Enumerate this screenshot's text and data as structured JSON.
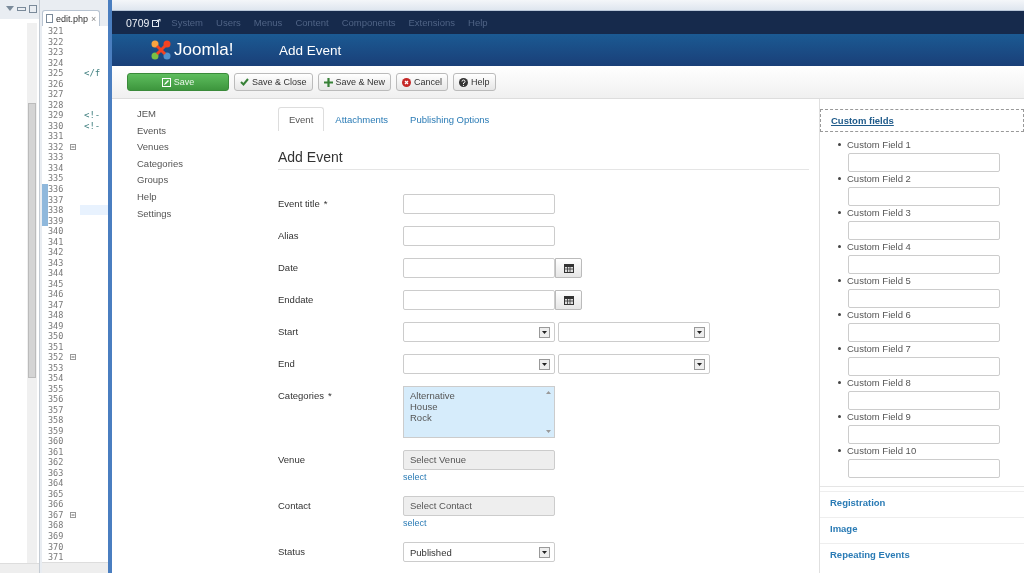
{
  "editor": {
    "tab": {
      "label": "edit.php",
      "close": "×"
    },
    "lines": [
      {
        "number": "321",
        "changed": false,
        "current": false,
        "fold": false
      },
      {
        "number": "322",
        "changed": false,
        "current": false,
        "fold": false
      },
      {
        "number": "323",
        "changed": false,
        "current": false,
        "fold": false
      },
      {
        "number": "324",
        "changed": false,
        "current": false,
        "fold": false
      },
      {
        "number": "325",
        "changed": false,
        "current": false,
        "fold": false,
        "code": "</f"
      },
      {
        "number": "326",
        "changed": false,
        "current": false,
        "fold": false
      },
      {
        "number": "327",
        "changed": false,
        "current": false,
        "fold": false
      },
      {
        "number": "328",
        "changed": false,
        "current": false,
        "fold": false
      },
      {
        "number": "329",
        "changed": false,
        "current": false,
        "fold": false,
        "code": "<!-"
      },
      {
        "number": "330",
        "changed": false,
        "current": false,
        "fold": false,
        "code": "<!-"
      },
      {
        "number": "331",
        "changed": false,
        "current": false,
        "fold": false
      },
      {
        "number": "332",
        "changed": false,
        "current": false,
        "fold": true
      },
      {
        "number": "333",
        "changed": false,
        "current": false,
        "fold": false
      },
      {
        "number": "334",
        "changed": false,
        "current": false,
        "fold": false
      },
      {
        "number": "335",
        "changed": false,
        "current": false,
        "fold": false
      },
      {
        "number": "336",
        "changed": true,
        "current": false,
        "fold": false
      },
      {
        "number": "337",
        "changed": true,
        "current": false,
        "fold": false
      },
      {
        "number": "338",
        "changed": true,
        "current": true,
        "fold": false
      },
      {
        "number": "339",
        "changed": true,
        "current": false,
        "fold": false
      },
      {
        "number": "340",
        "changed": false,
        "current": false,
        "fold": false
      },
      {
        "number": "341",
        "changed": false,
        "current": false,
        "fold": false
      },
      {
        "number": "342",
        "changed": false,
        "current": false,
        "fold": false
      },
      {
        "number": "343",
        "changed": false,
        "current": false,
        "fold": false
      },
      {
        "number": "344",
        "changed": false,
        "current": false,
        "fold": false
      },
      {
        "number": "345",
        "changed": false,
        "current": false,
        "fold": false
      },
      {
        "number": "346",
        "changed": false,
        "current": false,
        "fold": false
      },
      {
        "number": "347",
        "changed": false,
        "current": false,
        "fold": false
      },
      {
        "number": "348",
        "changed": false,
        "current": false,
        "fold": false
      },
      {
        "number": "349",
        "changed": false,
        "current": false,
        "fold": false
      },
      {
        "number": "350",
        "changed": false,
        "current": false,
        "fold": false
      },
      {
        "number": "351",
        "changed": false,
        "current": false,
        "fold": false
      },
      {
        "number": "352",
        "changed": false,
        "current": false,
        "fold": true
      },
      {
        "number": "353",
        "changed": false,
        "current": false,
        "fold": false
      },
      {
        "number": "354",
        "changed": false,
        "current": false,
        "fold": false
      },
      {
        "number": "355",
        "changed": false,
        "current": false,
        "fold": false
      },
      {
        "number": "356",
        "changed": false,
        "current": false,
        "fold": false
      },
      {
        "number": "357",
        "changed": false,
        "current": false,
        "fold": false
      },
      {
        "number": "358",
        "changed": false,
        "current": false,
        "fold": false
      },
      {
        "number": "359",
        "changed": false,
        "current": false,
        "fold": false
      },
      {
        "number": "360",
        "changed": false,
        "current": false,
        "fold": false
      },
      {
        "number": "361",
        "changed": false,
        "current": false,
        "fold": false
      },
      {
        "number": "362",
        "changed": false,
        "current": false,
        "fold": false
      },
      {
        "number": "363",
        "changed": false,
        "current": false,
        "fold": false
      },
      {
        "number": "364",
        "changed": false,
        "current": false,
        "fold": false
      },
      {
        "number": "365",
        "changed": false,
        "current": false,
        "fold": false
      },
      {
        "number": "366",
        "changed": false,
        "current": false,
        "fold": false
      },
      {
        "number": "367",
        "changed": false,
        "current": false,
        "fold": true
      },
      {
        "number": "368",
        "changed": false,
        "current": false,
        "fold": false
      },
      {
        "number": "369",
        "changed": false,
        "current": false,
        "fold": false
      },
      {
        "number": "370",
        "changed": false,
        "current": false,
        "fold": false
      },
      {
        "number": "371",
        "changed": false,
        "current": false,
        "fold": false
      }
    ]
  },
  "navbar": {
    "site": "0709",
    "menus": [
      {
        "label": "System",
        "disabled": true
      },
      {
        "label": "Users",
        "disabled": true
      },
      {
        "label": "Menus",
        "disabled": true
      },
      {
        "label": "Content",
        "disabled": true
      },
      {
        "label": "Components",
        "disabled": true
      },
      {
        "label": "Extensions",
        "disabled": true
      },
      {
        "label": "Help",
        "disabled": true
      }
    ]
  },
  "header": {
    "logo": "Joomla!",
    "title": "Add Event"
  },
  "toolbar": [
    {
      "label": "Save",
      "kind": "primary"
    },
    {
      "label": "Save & Close",
      "kind": "default"
    },
    {
      "label": "Save & New",
      "kind": "default"
    },
    {
      "label": "Cancel",
      "kind": "default"
    },
    {
      "label": "Help",
      "kind": "default"
    }
  ],
  "sidebar": {
    "items": [
      "JEM",
      "Events",
      "Venues",
      "Categories",
      "Groups",
      "Help",
      "Settings"
    ]
  },
  "tabs": [
    {
      "label": "Event",
      "selected": true
    },
    {
      "label": "Attachments",
      "selected": false
    },
    {
      "label": "Publishing Options",
      "selected": false
    }
  ],
  "form": {
    "heading": "Add Event",
    "fields": [
      {
        "label": "Event title",
        "required": "*",
        "kind": "text"
      },
      {
        "label": "Alias",
        "kind": "text"
      },
      {
        "label": "Date",
        "kind": "date"
      },
      {
        "label": "Enddate",
        "kind": "date"
      },
      {
        "label": "Start",
        "kind": "time"
      },
      {
        "label": "End",
        "kind": "time"
      },
      {
        "label": "Categories",
        "required": "*",
        "kind": "listbox",
        "options": [
          "Alternative",
          "House",
          "Rock"
        ]
      },
      {
        "label": "Venue",
        "kind": "modal",
        "value": "Select Venue",
        "link": "select"
      },
      {
        "label": "Contact",
        "kind": "modal",
        "value": "Select Contact",
        "link": "select"
      },
      {
        "label": "Status",
        "kind": "select",
        "value": "Published"
      }
    ]
  },
  "panel": {
    "sections": [
      {
        "title": "Custom fields",
        "expanded": true,
        "items": [
          "Custom Field 1",
          "Custom Field 2",
          "Custom Field 3",
          "Custom Field 4",
          "Custom Field 5",
          "Custom Field 6",
          "Custom Field 7",
          "Custom Field 8",
          "Custom Field 9",
          "Custom Field 10"
        ]
      },
      {
        "title": "Registration",
        "expanded": false
      },
      {
        "title": "Image",
        "expanded": false
      },
      {
        "title": "Repeating Events",
        "expanded": false
      }
    ]
  }
}
